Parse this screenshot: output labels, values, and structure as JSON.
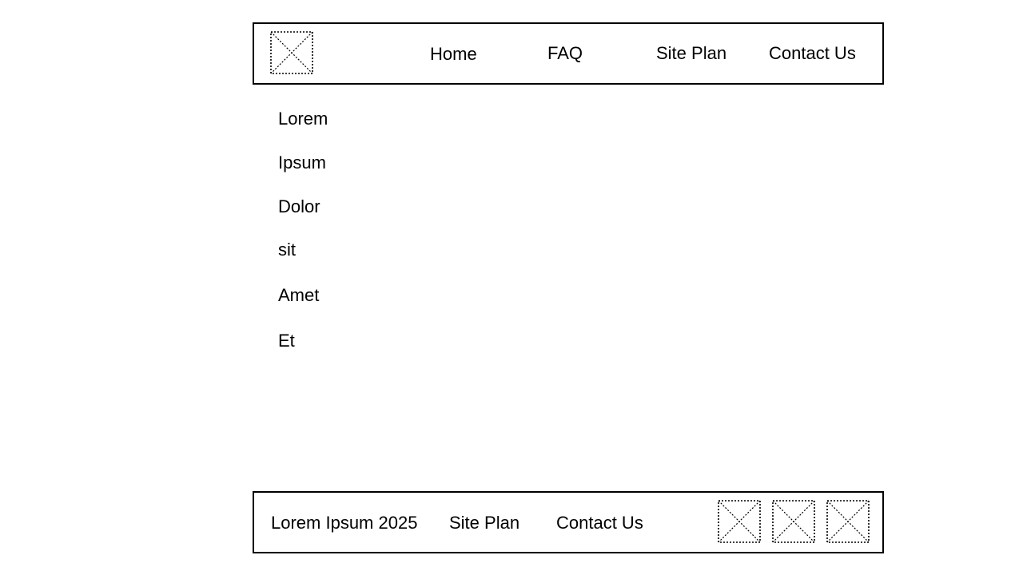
{
  "header": {
    "logo_icon": "image-placeholder-icon",
    "nav": [
      {
        "label": "Home"
      },
      {
        "label": "FAQ"
      },
      {
        "label": "Site Plan"
      },
      {
        "label": "Contact Us"
      }
    ]
  },
  "menu": {
    "items": [
      {
        "label": "Lorem"
      },
      {
        "label": "Ipsum"
      },
      {
        "label": "Dolor"
      },
      {
        "label": "sit"
      },
      {
        "label": "Amet"
      },
      {
        "label": "Et"
      }
    ]
  },
  "footer": {
    "copyright": "Lorem Ipsum 2025",
    "links": [
      {
        "label": "Site Plan"
      },
      {
        "label": "Contact Us"
      }
    ],
    "social_icons": [
      "image-placeholder-icon",
      "image-placeholder-icon",
      "image-placeholder-icon"
    ]
  },
  "colors": {
    "border": "#000000",
    "text": "#000000",
    "background": "#ffffff"
  }
}
